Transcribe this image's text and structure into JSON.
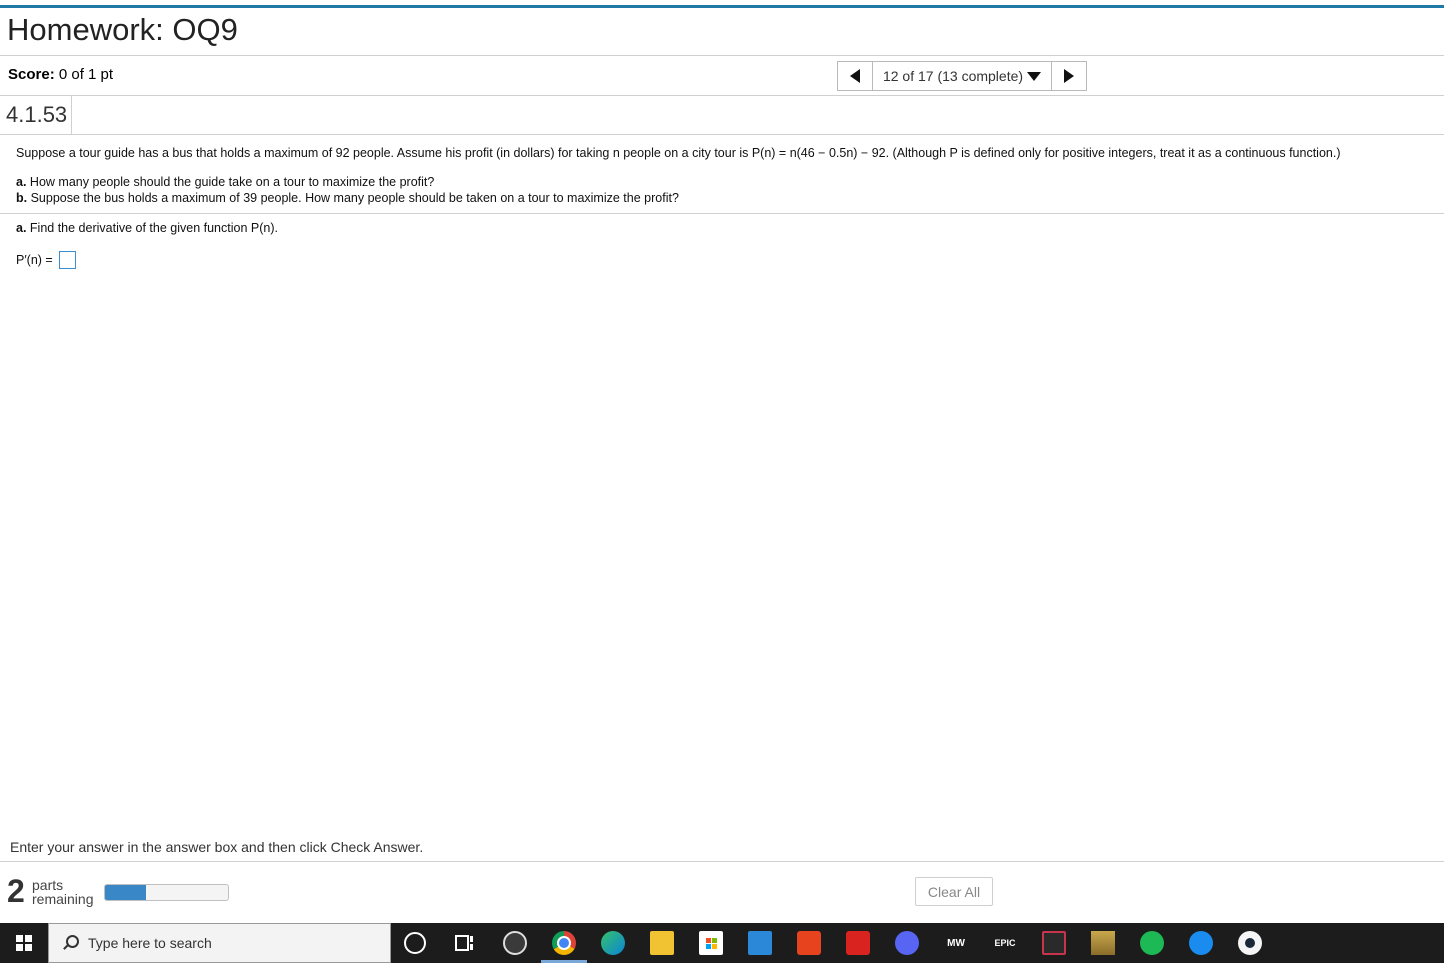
{
  "header": {
    "title": "Homework: OQ9"
  },
  "score": {
    "label": "Score:",
    "value": "0 of 1 pt"
  },
  "nav": {
    "position_text": "12 of 17 (13 complete)"
  },
  "problem": {
    "number": "4.1.53",
    "statement": "Suppose a tour guide has a bus that holds a maximum of 92 people. Assume his profit (in dollars) for taking n people on a city tour is P(n) = n(46 − 0.5n) − 92. (Although P is defined only for positive integers, treat it as a continuous function.)",
    "part_a_label": "a.",
    "part_a_text": "How many people should the guide take on a tour to maximize the profit?",
    "part_b_label": "b.",
    "part_b_text": "Suppose the bus holds a maximum of 39 people. How many people should be taken on a tour to maximize the profit?",
    "sub_a_label": "a.",
    "sub_a_text": "Find the derivative of the given function P(n).",
    "answer_label": "P′(n) ="
  },
  "footer": {
    "instruction": "Enter your answer in the answer box and then click Check Answer.",
    "parts_count": "2",
    "parts_word": "parts",
    "remaining_word": "remaining",
    "progress_fraction": 0.33,
    "clear_all_label": "Clear All"
  },
  "taskbar": {
    "search_placeholder": "Type here to search",
    "icons": [
      "cortana-icon",
      "task-view-icon",
      "app-icon",
      "chrome-icon",
      "edge-icon",
      "file-explorer-icon",
      "store-icon",
      "mail-icon",
      "office-icon",
      "acrobat-icon",
      "discord-icon",
      "mw-icon",
      "epic-games-icon",
      "valorant-icon",
      "league-icon",
      "spotify-icon",
      "battlenet-icon",
      "steam-icon"
    ],
    "epic_text": "EPIC",
    "mw_text": "MW"
  }
}
